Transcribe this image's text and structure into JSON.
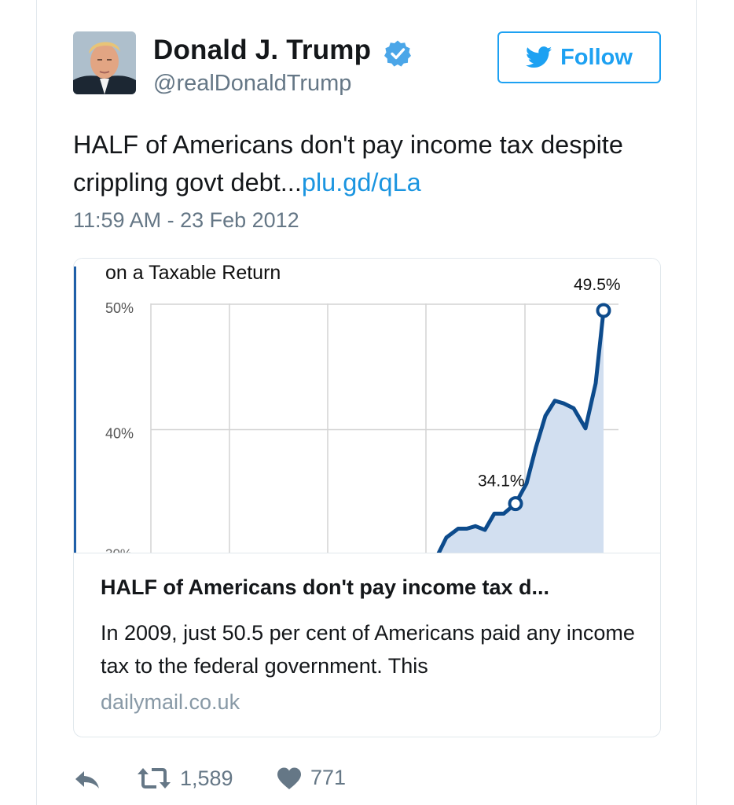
{
  "profile": {
    "display_name": "Donald J. Trump",
    "screen_name": "@realDonaldTrump",
    "verified_icon": "verified-badge-icon",
    "avatar": "profile-avatar"
  },
  "follow": {
    "label": "Follow",
    "icon": "twitter-bird-icon"
  },
  "tweet": {
    "text": "HALF of Americans don't pay income tax despite crippling govt debt...",
    "link": "plu.gd/qLa",
    "timestamp": "11:59 AM - 23 Feb 2012"
  },
  "card": {
    "chart_data": {
      "type": "area",
      "title": "on a Taxable Return",
      "y_ticks": [
        "50%",
        "40%"
      ],
      "ylim": [
        30,
        50
      ],
      "grid": true,
      "x": [
        0,
        1,
        2,
        3,
        4,
        5,
        6,
        7,
        8,
        9,
        10,
        11,
        12,
        13,
        14,
        15,
        16,
        17,
        18
      ],
      "values": [
        30.0,
        31.4,
        32.1,
        32.1,
        32.3,
        32.0,
        33.3,
        33.3,
        34.1,
        35.7,
        38.6,
        41.1,
        42.3,
        42.1,
        41.7,
        40.1,
        43.7,
        49.5
      ],
      "annotations": [
        {
          "label": "34.1%",
          "value": 34.1
        },
        {
          "label": "49.5%",
          "value": 49.5
        }
      ],
      "colors": {
        "line": "#0d4b8c",
        "fill": "#d2dff0",
        "grid": "#d4d4d4"
      }
    },
    "title": "HALF of Americans don't pay income tax d...",
    "description": "In 2009, just 50.5 per cent of Americans paid any income tax to the federal government. This",
    "domain": "dailymail.co.uk"
  },
  "actions": {
    "reply_icon": "reply-icon",
    "retweet_icon": "retweet-icon",
    "retweet_count": "1,589",
    "like_icon": "heart-icon",
    "like_count": "771"
  },
  "colors": {
    "accent": "#1da1f2",
    "link": "#1b95e0",
    "secondary_text": "#657786",
    "border": "#e1e8ed"
  }
}
